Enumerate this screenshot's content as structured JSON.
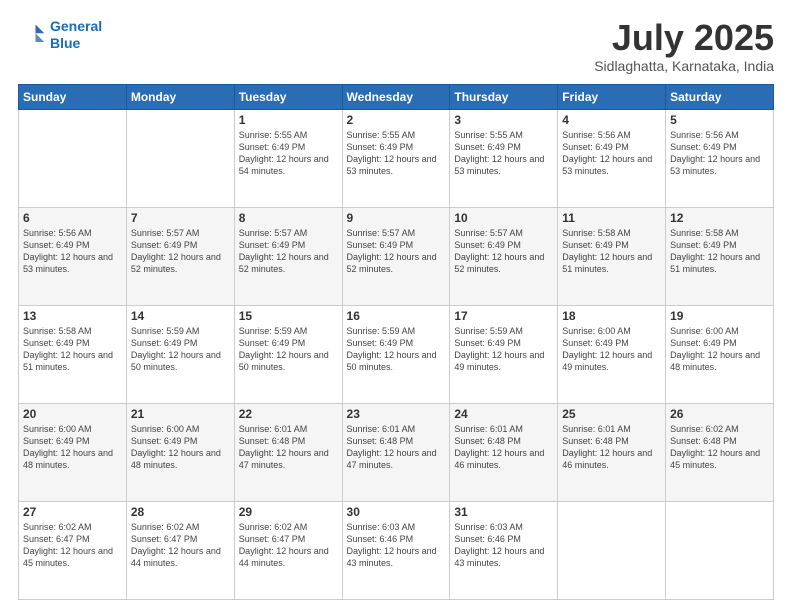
{
  "logo": {
    "line1": "General",
    "line2": "Blue"
  },
  "header": {
    "month": "July 2025",
    "location": "Sidlaghatta, Karnataka, India"
  },
  "weekdays": [
    "Sunday",
    "Monday",
    "Tuesday",
    "Wednesday",
    "Thursday",
    "Friday",
    "Saturday"
  ],
  "weeks": [
    [
      {
        "day": "",
        "sunrise": "",
        "sunset": "",
        "daylight": ""
      },
      {
        "day": "",
        "sunrise": "",
        "sunset": "",
        "daylight": ""
      },
      {
        "day": "1",
        "sunrise": "Sunrise: 5:55 AM",
        "sunset": "Sunset: 6:49 PM",
        "daylight": "Daylight: 12 hours and 54 minutes."
      },
      {
        "day": "2",
        "sunrise": "Sunrise: 5:55 AM",
        "sunset": "Sunset: 6:49 PM",
        "daylight": "Daylight: 12 hours and 53 minutes."
      },
      {
        "day": "3",
        "sunrise": "Sunrise: 5:55 AM",
        "sunset": "Sunset: 6:49 PM",
        "daylight": "Daylight: 12 hours and 53 minutes."
      },
      {
        "day": "4",
        "sunrise": "Sunrise: 5:56 AM",
        "sunset": "Sunset: 6:49 PM",
        "daylight": "Daylight: 12 hours and 53 minutes."
      },
      {
        "day": "5",
        "sunrise": "Sunrise: 5:56 AM",
        "sunset": "Sunset: 6:49 PM",
        "daylight": "Daylight: 12 hours and 53 minutes."
      }
    ],
    [
      {
        "day": "6",
        "sunrise": "Sunrise: 5:56 AM",
        "sunset": "Sunset: 6:49 PM",
        "daylight": "Daylight: 12 hours and 53 minutes."
      },
      {
        "day": "7",
        "sunrise": "Sunrise: 5:57 AM",
        "sunset": "Sunset: 6:49 PM",
        "daylight": "Daylight: 12 hours and 52 minutes."
      },
      {
        "day": "8",
        "sunrise": "Sunrise: 5:57 AM",
        "sunset": "Sunset: 6:49 PM",
        "daylight": "Daylight: 12 hours and 52 minutes."
      },
      {
        "day": "9",
        "sunrise": "Sunrise: 5:57 AM",
        "sunset": "Sunset: 6:49 PM",
        "daylight": "Daylight: 12 hours and 52 minutes."
      },
      {
        "day": "10",
        "sunrise": "Sunrise: 5:57 AM",
        "sunset": "Sunset: 6:49 PM",
        "daylight": "Daylight: 12 hours and 52 minutes."
      },
      {
        "day": "11",
        "sunrise": "Sunrise: 5:58 AM",
        "sunset": "Sunset: 6:49 PM",
        "daylight": "Daylight: 12 hours and 51 minutes."
      },
      {
        "day": "12",
        "sunrise": "Sunrise: 5:58 AM",
        "sunset": "Sunset: 6:49 PM",
        "daylight": "Daylight: 12 hours and 51 minutes."
      }
    ],
    [
      {
        "day": "13",
        "sunrise": "Sunrise: 5:58 AM",
        "sunset": "Sunset: 6:49 PM",
        "daylight": "Daylight: 12 hours and 51 minutes."
      },
      {
        "day": "14",
        "sunrise": "Sunrise: 5:59 AM",
        "sunset": "Sunset: 6:49 PM",
        "daylight": "Daylight: 12 hours and 50 minutes."
      },
      {
        "day": "15",
        "sunrise": "Sunrise: 5:59 AM",
        "sunset": "Sunset: 6:49 PM",
        "daylight": "Daylight: 12 hours and 50 minutes."
      },
      {
        "day": "16",
        "sunrise": "Sunrise: 5:59 AM",
        "sunset": "Sunset: 6:49 PM",
        "daylight": "Daylight: 12 hours and 50 minutes."
      },
      {
        "day": "17",
        "sunrise": "Sunrise: 5:59 AM",
        "sunset": "Sunset: 6:49 PM",
        "daylight": "Daylight: 12 hours and 49 minutes."
      },
      {
        "day": "18",
        "sunrise": "Sunrise: 6:00 AM",
        "sunset": "Sunset: 6:49 PM",
        "daylight": "Daylight: 12 hours and 49 minutes."
      },
      {
        "day": "19",
        "sunrise": "Sunrise: 6:00 AM",
        "sunset": "Sunset: 6:49 PM",
        "daylight": "Daylight: 12 hours and 48 minutes."
      }
    ],
    [
      {
        "day": "20",
        "sunrise": "Sunrise: 6:00 AM",
        "sunset": "Sunset: 6:49 PM",
        "daylight": "Daylight: 12 hours and 48 minutes."
      },
      {
        "day": "21",
        "sunrise": "Sunrise: 6:00 AM",
        "sunset": "Sunset: 6:49 PM",
        "daylight": "Daylight: 12 hours and 48 minutes."
      },
      {
        "day": "22",
        "sunrise": "Sunrise: 6:01 AM",
        "sunset": "Sunset: 6:48 PM",
        "daylight": "Daylight: 12 hours and 47 minutes."
      },
      {
        "day": "23",
        "sunrise": "Sunrise: 6:01 AM",
        "sunset": "Sunset: 6:48 PM",
        "daylight": "Daylight: 12 hours and 47 minutes."
      },
      {
        "day": "24",
        "sunrise": "Sunrise: 6:01 AM",
        "sunset": "Sunset: 6:48 PM",
        "daylight": "Daylight: 12 hours and 46 minutes."
      },
      {
        "day": "25",
        "sunrise": "Sunrise: 6:01 AM",
        "sunset": "Sunset: 6:48 PM",
        "daylight": "Daylight: 12 hours and 46 minutes."
      },
      {
        "day": "26",
        "sunrise": "Sunrise: 6:02 AM",
        "sunset": "Sunset: 6:48 PM",
        "daylight": "Daylight: 12 hours and 45 minutes."
      }
    ],
    [
      {
        "day": "27",
        "sunrise": "Sunrise: 6:02 AM",
        "sunset": "Sunset: 6:47 PM",
        "daylight": "Daylight: 12 hours and 45 minutes."
      },
      {
        "day": "28",
        "sunrise": "Sunrise: 6:02 AM",
        "sunset": "Sunset: 6:47 PM",
        "daylight": "Daylight: 12 hours and 44 minutes."
      },
      {
        "day": "29",
        "sunrise": "Sunrise: 6:02 AM",
        "sunset": "Sunset: 6:47 PM",
        "daylight": "Daylight: 12 hours and 44 minutes."
      },
      {
        "day": "30",
        "sunrise": "Sunrise: 6:03 AM",
        "sunset": "Sunset: 6:46 PM",
        "daylight": "Daylight: 12 hours and 43 minutes."
      },
      {
        "day": "31",
        "sunrise": "Sunrise: 6:03 AM",
        "sunset": "Sunset: 6:46 PM",
        "daylight": "Daylight: 12 hours and 43 minutes."
      },
      {
        "day": "",
        "sunrise": "",
        "sunset": "",
        "daylight": ""
      },
      {
        "day": "",
        "sunrise": "",
        "sunset": "",
        "daylight": ""
      }
    ]
  ]
}
